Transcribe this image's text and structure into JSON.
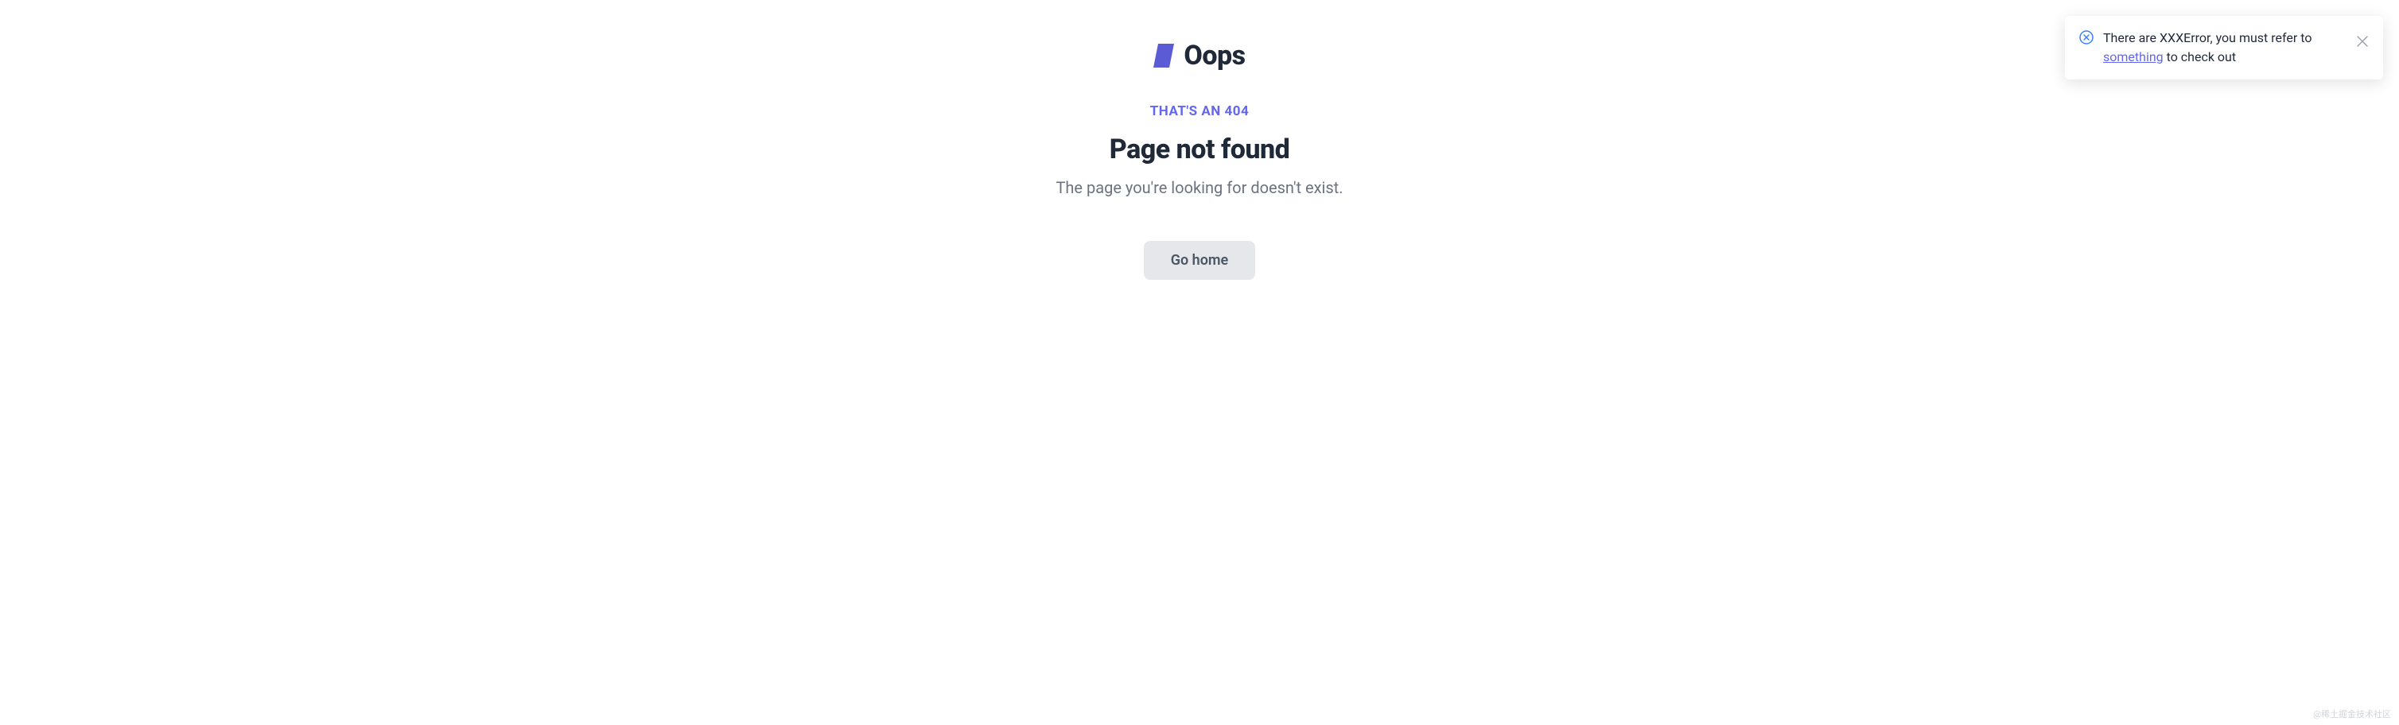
{
  "header": {
    "title": "Oops"
  },
  "error": {
    "subtitle": "THAT'S AN 404",
    "heading": "Page not found",
    "description": "The page you're looking for doesn't exist."
  },
  "actions": {
    "home_button": "Go home"
  },
  "notification": {
    "text_before": "There are XXXError, you must refer to ",
    "link_text": "something",
    "text_after": " to check out"
  },
  "watermark": "@稀土掘金技术社区"
}
